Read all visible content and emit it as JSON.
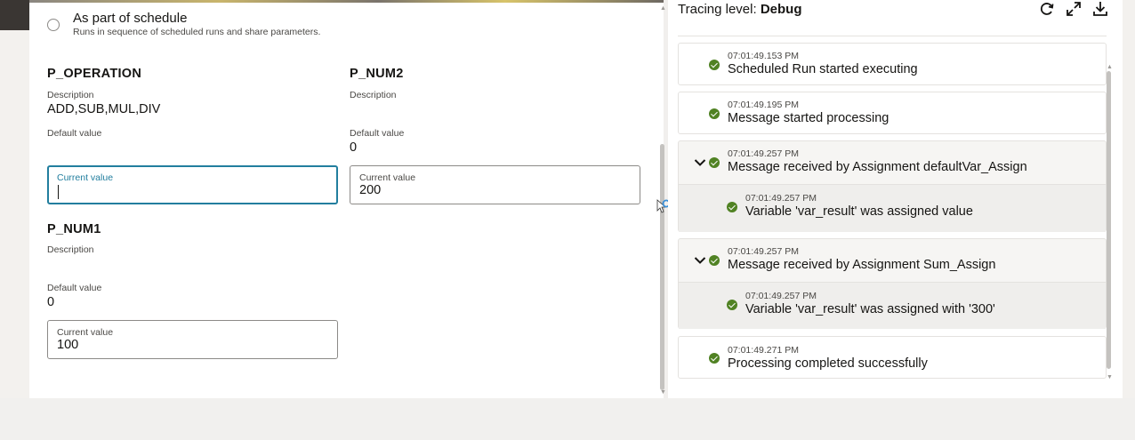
{
  "schedule_option": {
    "title": "As part of schedule",
    "subtitle": "Runs in sequence of scheduled runs and share parameters."
  },
  "params": [
    {
      "name": "P_OPERATION",
      "description_label": "Description",
      "description": "ADD,SUB,MUL,DIV",
      "default_label": "Default value",
      "default": "",
      "current_label": "Current value",
      "current": ""
    },
    {
      "name": "P_NUM2",
      "description_label": "Description",
      "description": "",
      "default_label": "Default value",
      "default": "0",
      "current_label": "Current value",
      "current": "200"
    },
    {
      "name": "P_NUM1",
      "description_label": "Description",
      "description": "",
      "default_label": "Default value",
      "default": "0",
      "current_label": "Current value",
      "current": "100"
    }
  ],
  "trace": {
    "label": "Tracing level:",
    "level": "Debug",
    "icons": [
      "refresh-icon",
      "expand-icon",
      "download-icon"
    ],
    "entries": [
      {
        "time": "07:01:49.153 PM",
        "message": "Scheduled Run started executing"
      },
      {
        "time": "07:01:49.195 PM",
        "message": "Message started processing"
      },
      {
        "time": "07:01:49.257 PM",
        "message": "Message received by Assignment defaultVar_Assign",
        "child": {
          "time": "07:01:49.257 PM",
          "message": "Variable 'var_result' was assigned value"
        }
      },
      {
        "time": "07:01:49.257 PM",
        "message": "Message received by Assignment Sum_Assign",
        "child": {
          "time": "07:01:49.257 PM",
          "message": "Variable 'var_result' was assigned with '300'"
        }
      },
      {
        "time": "07:01:49.271 PM",
        "message": "Processing completed successfully"
      }
    ]
  },
  "colors": {
    "success": "#508223",
    "focus": "#227e9e"
  }
}
